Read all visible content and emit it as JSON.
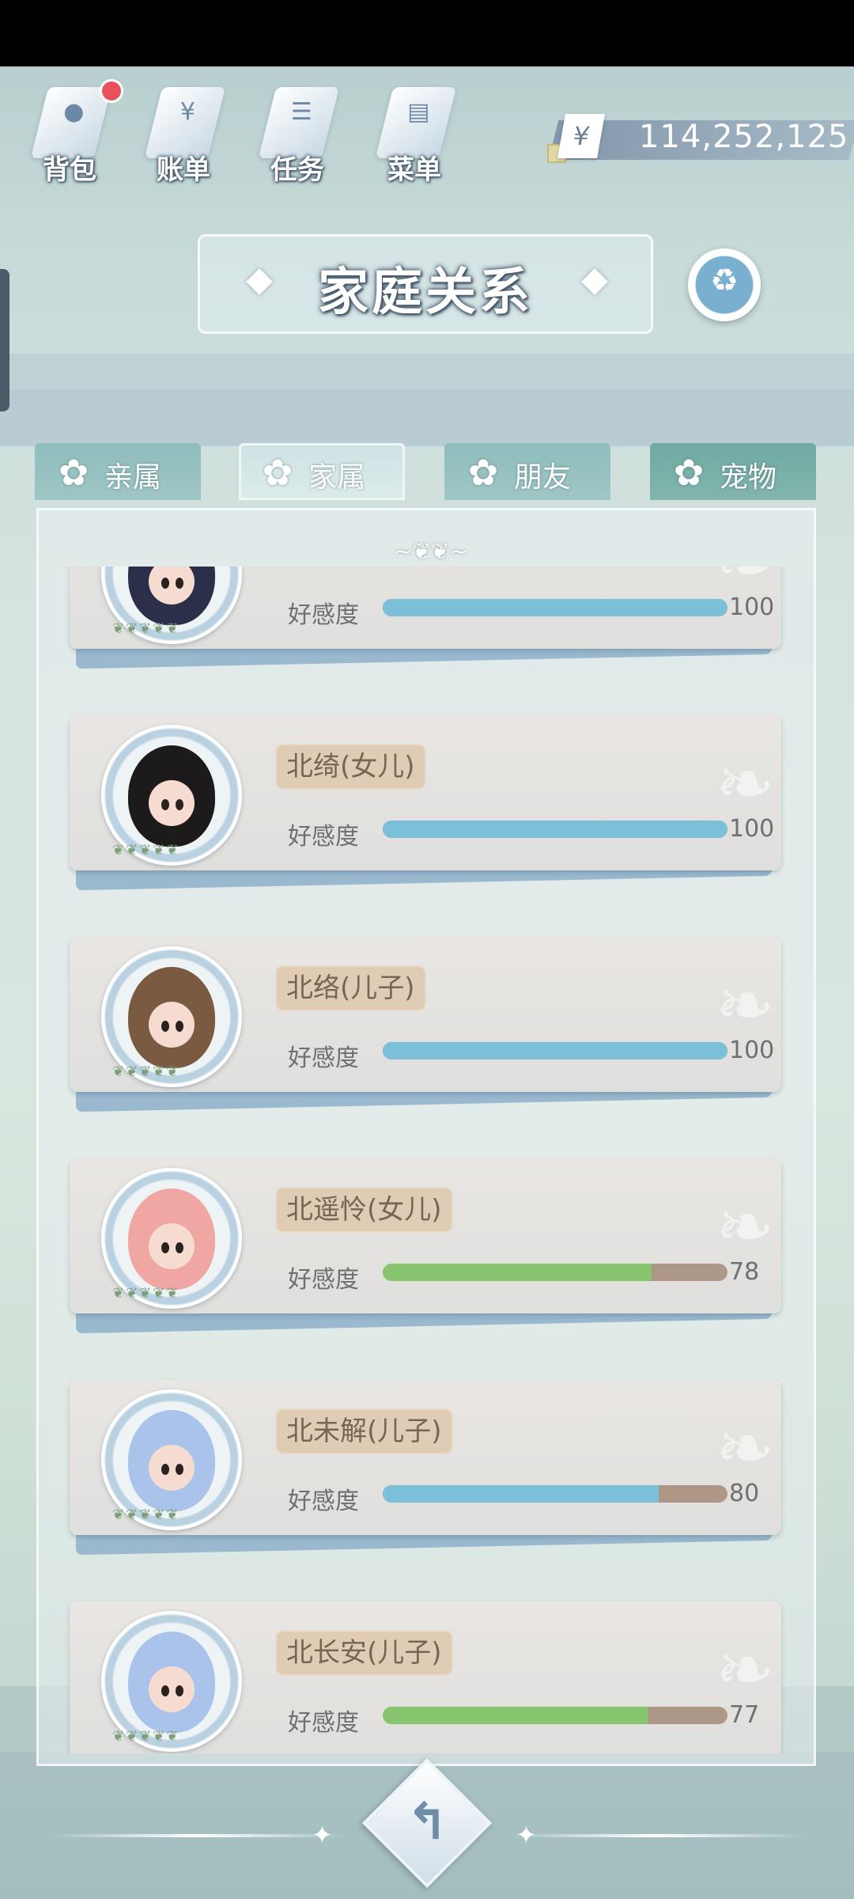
{
  "top_menu": {
    "items": [
      {
        "label": "背包",
        "icon": "backpack-icon",
        "glyph": "●",
        "badge": true
      },
      {
        "label": "账单",
        "icon": "bill-icon",
        "glyph": "¥",
        "badge": false
      },
      {
        "label": "任务",
        "icon": "task-icon",
        "glyph": "☰",
        "badge": false
      },
      {
        "label": "菜单",
        "icon": "menu-icon",
        "glyph": "▤",
        "badge": false
      }
    ]
  },
  "currency": {
    "symbol": "¥",
    "value": "114,252,125"
  },
  "title": {
    "text": "家庭关系",
    "family_tree_glyph": "♻"
  },
  "tabs": [
    {
      "label": "亲属",
      "active": false
    },
    {
      "label": "家属",
      "active": true
    },
    {
      "label": "朋友",
      "active": false
    },
    {
      "label": "宠物",
      "active": false
    }
  ],
  "ornament": "~❦❦~",
  "members": [
    {
      "name": "",
      "favor_label": "好感度",
      "favor": 100,
      "bar_color": "#7bbfd8",
      "hair": "#2b2f4a",
      "outfit": "#3c3355"
    },
    {
      "name": "北绮(女儿)",
      "favor_label": "好感度",
      "favor": 100,
      "bar_color": "#7bbfd8",
      "hair": "#1c1a1a",
      "outfit": "#d9d9d9"
    },
    {
      "name": "北络(儿子)",
      "favor_label": "好感度",
      "favor": 100,
      "bar_color": "#7bbfd8",
      "hair": "#7a5a40",
      "outfit": "#d8dde6"
    },
    {
      "name": "北遥怜(女儿)",
      "favor_label": "好感度",
      "favor": 78,
      "bar_color": "#86c56e",
      "hair": "#f0a6a2",
      "outfit": "#f2b7b2"
    },
    {
      "name": "北未解(儿子)",
      "favor_label": "好感度",
      "favor": 80,
      "bar_color": "#7bbfd8",
      "hair": "#a9c3ea",
      "outfit": "#b9cdee"
    },
    {
      "name": "北长安(儿子)",
      "favor_label": "好感度",
      "favor": 77,
      "bar_color": "#86c56e",
      "hair": "#a9c3ea",
      "outfit": "#b9cdee"
    }
  ],
  "return_glyph": "↰"
}
